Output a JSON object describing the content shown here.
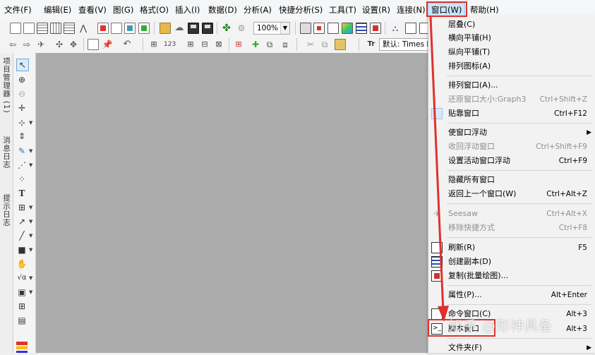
{
  "menubar": {
    "items": [
      {
        "label": "文件(F)"
      },
      {
        "label": "编辑(E)"
      },
      {
        "label": "查看(V)"
      },
      {
        "label": "图(G)"
      },
      {
        "label": "格式(O)"
      },
      {
        "label": "插入(I)"
      },
      {
        "label": "数据(D)"
      },
      {
        "label": "分析(A)"
      },
      {
        "label": "快捷分析(S)"
      },
      {
        "label": "工具(T)"
      },
      {
        "label": "设置(R)"
      },
      {
        "label": "连接(N)"
      },
      {
        "label": "窗口(W)"
      },
      {
        "label": "帮助(H)"
      }
    ]
  },
  "toolbar": {
    "zoom_value": "100%",
    "font_value": "默认: Times Ne"
  },
  "left_tabs": [
    "项目管理器 (1)",
    "消息日志",
    "提示日志"
  ],
  "window_menu": {
    "items": [
      {
        "label": "层叠(C)",
        "shortcut": "",
        "disabled": false
      },
      {
        "label": "横向平铺(H)",
        "shortcut": "",
        "disabled": false
      },
      {
        "label": "纵向平铺(T)",
        "shortcut": "",
        "disabled": false
      },
      {
        "label": "排列图标(A)",
        "shortcut": "",
        "disabled": false
      },
      {
        "label": "排列窗口(A)...",
        "shortcut": "",
        "disabled": false
      },
      {
        "label": "还原窗口大小:Graph3",
        "shortcut": "Ctrl+Shift+Z",
        "disabled": true
      },
      {
        "label": "贴靠窗口",
        "shortcut": "Ctrl+F12",
        "disabled": false
      },
      {
        "label": "使窗口浮动",
        "shortcut": "",
        "disabled": false
      },
      {
        "label": "收回浮动窗口",
        "shortcut": "Ctrl+Shift+F9",
        "disabled": true
      },
      {
        "label": "设置活动窗口浮动",
        "shortcut": "Ctrl+F9",
        "disabled": false
      },
      {
        "label": "隐藏所有窗口",
        "shortcut": "",
        "disabled": false
      },
      {
        "label": "返回上一个窗口(W)",
        "shortcut": "Ctrl+Alt+Z",
        "disabled": false
      },
      {
        "label": "Seesaw",
        "shortcut": "Ctrl+Alt+X",
        "disabled": true
      },
      {
        "label": "移除快捷方式",
        "shortcut": "Ctrl+F8",
        "disabled": true
      },
      {
        "label": "刷新(R)",
        "shortcut": "F5",
        "disabled": false
      },
      {
        "label": "创建副本(D)",
        "shortcut": "",
        "disabled": false
      },
      {
        "label": "复制(批量绘图)...",
        "shortcut": "",
        "disabled": false
      },
      {
        "label": "属性(P)...",
        "shortcut": "Alt+Enter",
        "disabled": false
      },
      {
        "label": "命令窗口(C)",
        "shortcut": "Alt+3",
        "disabled": false
      },
      {
        "label": "脚本窗口",
        "shortcut": "Alt+3",
        "disabled": false
      },
      {
        "label": "文件夹(F)",
        "shortcut": "",
        "disabled": false
      }
    ]
  },
  "watermark": "知乎 @形神具备",
  "colors": {
    "workspace": "#ababab",
    "annotation_red": "#e0312d",
    "menu_highlight": "#cce4f7"
  }
}
